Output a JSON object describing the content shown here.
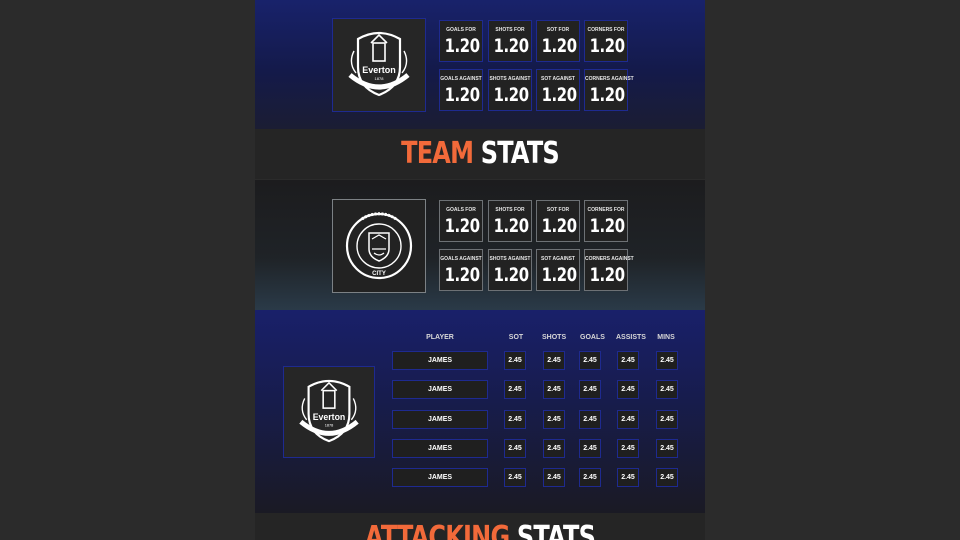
{
  "team_a": {
    "crest": "everton-crest",
    "stats": [
      {
        "label": "Goals For",
        "value": "1.20"
      },
      {
        "label": "Shots For",
        "value": "1.20"
      },
      {
        "label": "SOT For",
        "value": "1.20"
      },
      {
        "label": "Corners For",
        "value": "1.20"
      },
      {
        "label": "Goals Against",
        "value": "1.20"
      },
      {
        "label": "Shots Against",
        "value": "1.20"
      },
      {
        "label": "SOT Against",
        "value": "1.20"
      },
      {
        "label": "Corners Against",
        "value": "1.20"
      }
    ]
  },
  "team_stats_heading": {
    "accent": "TEAM",
    "rest": "STATS"
  },
  "team_b": {
    "crest": "manchester-city-crest",
    "stats": [
      {
        "label": "Goals For",
        "value": "1.20"
      },
      {
        "label": "Shots For",
        "value": "1.20"
      },
      {
        "label": "SOT For",
        "value": "1.20"
      },
      {
        "label": "Corners For",
        "value": "1.20"
      },
      {
        "label": "Goals Against",
        "value": "1.20"
      },
      {
        "label": "Shots Against",
        "value": "1.20"
      },
      {
        "label": "SOT Against",
        "value": "1.20"
      },
      {
        "label": "Corners Against",
        "value": "1.20"
      }
    ]
  },
  "players": {
    "crest": "everton-crest",
    "headers": [
      "Player",
      "SOT",
      "Shots",
      "Goals",
      "Assists",
      "Mins"
    ],
    "rows": [
      {
        "name": "JAMES",
        "values": [
          "2.45",
          "2.45",
          "2.45",
          "2.45",
          "2.45"
        ]
      },
      {
        "name": "JAMES",
        "values": [
          "2.45",
          "2.45",
          "2.45",
          "2.45",
          "2.45"
        ]
      },
      {
        "name": "JAMES",
        "values": [
          "2.45",
          "2.45",
          "2.45",
          "2.45",
          "2.45"
        ]
      },
      {
        "name": "JAMES",
        "values": [
          "2.45",
          "2.45",
          "2.45",
          "2.45",
          "2.45"
        ]
      },
      {
        "name": "JAMES",
        "values": [
          "2.45",
          "2.45",
          "2.45",
          "2.45",
          "2.45"
        ]
      }
    ]
  },
  "attacking_heading": {
    "accent": "ATTACKING",
    "rest": "STATS"
  },
  "colors": {
    "accent": "#f26a3a",
    "border_blue": "#1e2a90",
    "band_blue": "#18226b"
  }
}
